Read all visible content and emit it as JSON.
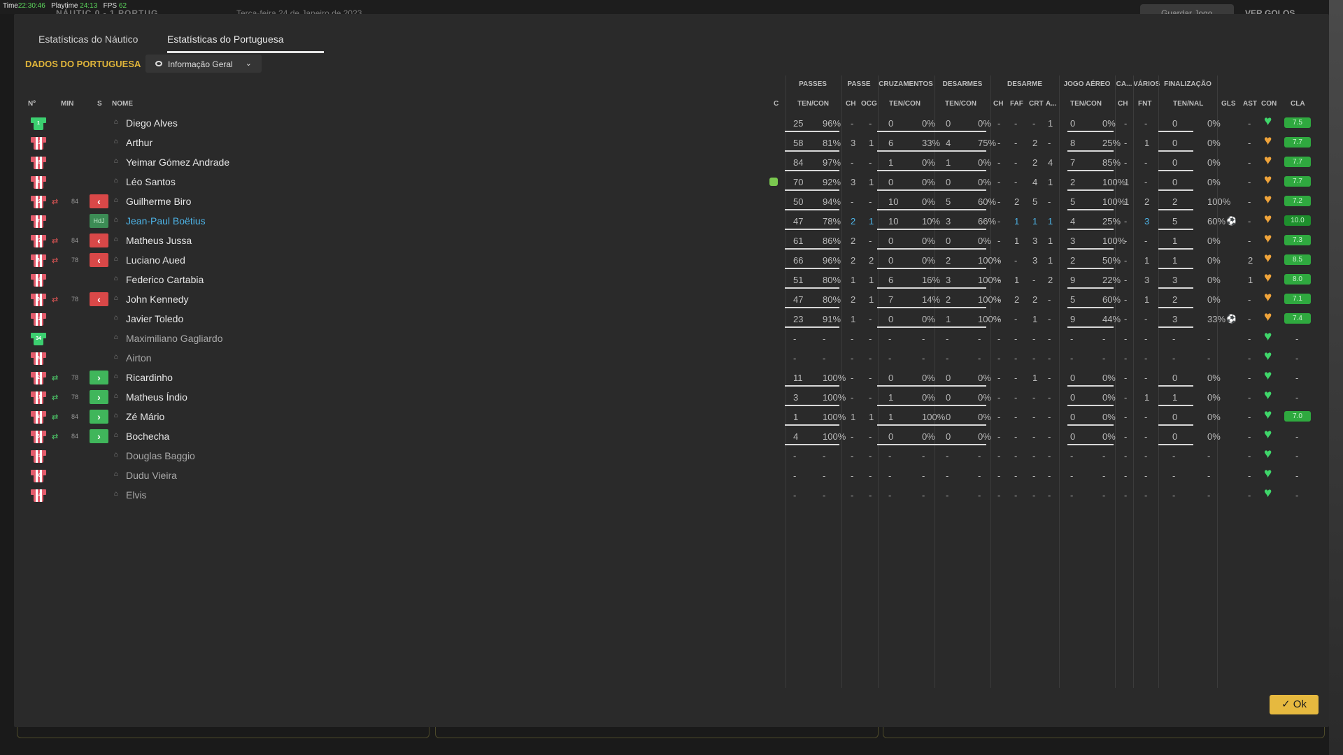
{
  "topbar": {
    "time_label": "Time",
    "time": "22:30:46",
    "playtime_label": "Playtime",
    "playtime": "24:13",
    "fps_label": "FPS",
    "fps": "62",
    "score": "NÁUTIC 0 - 1 PORTUG",
    "date": "Terça-feira 24 de Janeiro de 2023",
    "save_label": "Guardar Jogo",
    "goals_label": "VER GOLOS"
  },
  "tabs": [
    {
      "label": "Estatísticas do Náutico"
    },
    {
      "label": "Estatísticas do Portuguesa"
    }
  ],
  "section_title": "DADOS DO PORTUGUESA",
  "dropdown_label": "Informação Geral",
  "groups": {
    "passes": "PASSES",
    "passe": "PASSE",
    "cruzamentos": "CRUZAMENTOS",
    "desarmes": "DESARMES",
    "desarme": "DESARME",
    "jogo_aereo": "JOGO AÉREO",
    "ca": "CA...",
    "varios": "VÁRIOS",
    "finalizacao": "FINALIZAÇÃO"
  },
  "cols": {
    "no": "Nº",
    "min": "MIN",
    "s": "S",
    "nome": "NOME",
    "c": "C",
    "passes_tc": "TEN/CON",
    "passe_ch": "CH",
    "passe_ocg": "OCG",
    "cruz_tc": "TEN/CON",
    "des_tc": "TEN/CON",
    "d_ch": "CH",
    "d_faf": "FAF",
    "d_crt": "CRT",
    "d_a": "A...",
    "aer_tc": "TEN/CON",
    "ca_ch": "CH",
    "fnt": "FNT",
    "fin_tn": "TEN/NAL",
    "gls": "GLS",
    "ast": "AST",
    "con": "CON",
    "cla": "CLA"
  },
  "rows": [
    {
      "num": "1",
      "gk": true,
      "name": "Diego Alves",
      "v": [
        "25",
        "96%",
        "-",
        "-",
        "0",
        "0%",
        "0",
        "0%",
        "-",
        "-",
        "-",
        "1",
        "0",
        "0%",
        "-",
        "-",
        "0",
        "0%",
        "",
        "-"
      ],
      "con": "green",
      "rating": "7.5"
    },
    {
      "num": "13",
      "name": "Arthur",
      "v": [
        "58",
        "81%",
        "3",
        "1",
        "6",
        "33%",
        "4",
        "75%",
        "-",
        "-",
        "2",
        "-",
        "8",
        "25%",
        "-",
        "1",
        "0",
        "0%",
        "",
        "-"
      ],
      "con": "orange",
      "rating": "7.7"
    },
    {
      "num": "28",
      "name": "Yeimar Gómez Andrade",
      "v": [
        "84",
        "97%",
        "-",
        "-",
        "1",
        "0%",
        "1",
        "0%",
        "-",
        "-",
        "2",
        "4",
        "7",
        "85%",
        "-",
        "-",
        "0",
        "0%",
        "",
        "-"
      ],
      "con": "orange",
      "rating": "7.7"
    },
    {
      "num": "4",
      "name": "Léo Santos",
      "card": true,
      "v": [
        "70",
        "92%",
        "3",
        "1",
        "0",
        "0%",
        "0",
        "0%",
        "-",
        "-",
        "4",
        "1",
        "2",
        "100%",
        "1",
        "-",
        "0",
        "0%",
        "",
        "-"
      ],
      "con": "orange",
      "rating": "7.7"
    },
    {
      "num": "22",
      "sub": "out",
      "min": "84",
      "name": "Guilherme Biro",
      "v": [
        "50",
        "94%",
        "-",
        "-",
        "10",
        "0%",
        "5",
        "60%",
        "-",
        "2",
        "5",
        "-",
        "5",
        "100%",
        "1",
        "2",
        "2",
        "100%",
        "",
        "-"
      ],
      "con": "orange",
      "rating": "7.2"
    },
    {
      "num": "7",
      "hdj": "HdJ",
      "motm": true,
      "name": "Jean-Paul Boëtius",
      "v": [
        "47",
        "78%",
        "2",
        "1",
        "10",
        "10%",
        "3",
        "66%",
        "-",
        "1",
        "1",
        "1",
        "4",
        "25%",
        "-",
        "3",
        "5",
        "60%",
        "3",
        "-"
      ],
      "con": "orange",
      "rating": "10.0",
      "goals": true
    },
    {
      "num": "27",
      "sub": "out",
      "min": "84",
      "name": "Matheus Jussa",
      "v": [
        "61",
        "86%",
        "2",
        "-",
        "0",
        "0%",
        "0",
        "0%",
        "-",
        "1",
        "3",
        "1",
        "3",
        "100%",
        "-",
        "-",
        "1",
        "0%",
        "",
        "-"
      ],
      "con": "orange",
      "rating": "7.3"
    },
    {
      "num": "6",
      "sub": "out",
      "min": "78",
      "name": "Luciano Aued",
      "v": [
        "66",
        "96%",
        "2",
        "2",
        "0",
        "0%",
        "2",
        "100%",
        "-",
        "-",
        "3",
        "1",
        "2",
        "50%",
        "-",
        "1",
        "1",
        "0%",
        "",
        "2"
      ],
      "con": "orange",
      "rating": "8.5"
    },
    {
      "num": "10",
      "name": "Federico Cartabia",
      "v": [
        "51",
        "80%",
        "1",
        "1",
        "6",
        "16%",
        "3",
        "100%",
        "-",
        "1",
        "-",
        "2",
        "9",
        "22%",
        "-",
        "3",
        "3",
        "0%",
        "",
        "1"
      ],
      "con": "orange",
      "rating": "8.0"
    },
    {
      "num": "9",
      "sub": "out",
      "min": "78",
      "name": "John Kennedy",
      "v": [
        "47",
        "80%",
        "2",
        "1",
        "7",
        "14%",
        "2",
        "100%",
        "-",
        "2",
        "2",
        "-",
        "5",
        "60%",
        "-",
        "1",
        "2",
        "0%",
        "",
        "-"
      ],
      "con": "orange",
      "rating": "7.1"
    },
    {
      "num": "12",
      "name": "Javier Toledo",
      "v": [
        "23",
        "91%",
        "1",
        "-",
        "0",
        "0%",
        "1",
        "100%",
        "-",
        "-",
        "1",
        "-",
        "9",
        "44%",
        "-",
        "-",
        "3",
        "33%",
        "",
        "-"
      ],
      "con": "orange",
      "rating": "7.4",
      "goals": true
    },
    {
      "num": "34",
      "gk": true,
      "bench": true,
      "name": "Maximiliano Gagliardo",
      "v": [
        "-",
        "-",
        "-",
        "-",
        "-",
        "-",
        "-",
        "-",
        "-",
        "-",
        "-",
        "-",
        "-",
        "-",
        "-",
        "-",
        "-",
        "-",
        "",
        "-"
      ],
      "con": "green",
      "rating": "-"
    },
    {
      "num": "5",
      "bench": true,
      "name": "Airton",
      "v": [
        "-",
        "-",
        "-",
        "-",
        "-",
        "-",
        "-",
        "-",
        "-",
        "-",
        "-",
        "-",
        "-",
        "-",
        "-",
        "-",
        "-",
        "-",
        "",
        "-"
      ],
      "con": "green",
      "rating": "-"
    },
    {
      "num": "2",
      "sub": "in",
      "min": "78",
      "name": "Ricardinho",
      "v": [
        "11",
        "100%",
        "-",
        "-",
        "0",
        "0%",
        "0",
        "0%",
        "-",
        "-",
        "1",
        "-",
        "0",
        "0%",
        "-",
        "-",
        "0",
        "0%",
        "",
        "-"
      ],
      "con": "green",
      "rating": "-"
    },
    {
      "num": "11",
      "sub": "in",
      "min": "78",
      "name": "Matheus Índio",
      "v": [
        "3",
        "100%",
        "-",
        "-",
        "1",
        "0%",
        "0",
        "0%",
        "-",
        "-",
        "-",
        "-",
        "0",
        "0%",
        "-",
        "1",
        "1",
        "0%",
        "",
        "-"
      ],
      "con": "green",
      "rating": "-"
    },
    {
      "num": "8",
      "sub": "in",
      "min": "84",
      "name": "Zé Mário",
      "v": [
        "1",
        "100%",
        "1",
        "1",
        "1",
        "100%",
        "0",
        "0%",
        "-",
        "-",
        "-",
        "-",
        "0",
        "0%",
        "-",
        "-",
        "0",
        "0%",
        "",
        "-"
      ],
      "con": "green",
      "rating": "7.0"
    },
    {
      "num": "3",
      "sub": "in",
      "min": "84",
      "name": "Bochecha",
      "v": [
        "4",
        "100%",
        "-",
        "-",
        "0",
        "0%",
        "0",
        "0%",
        "-",
        "-",
        "-",
        "-",
        "0",
        "0%",
        "-",
        "-",
        "0",
        "0%",
        "",
        "-"
      ],
      "con": "green",
      "rating": "-"
    },
    {
      "num": "21",
      "bench": true,
      "name": "Douglas Baggio",
      "v": [
        "-",
        "-",
        "-",
        "-",
        "-",
        "-",
        "-",
        "-",
        "-",
        "-",
        "-",
        "-",
        "-",
        "-",
        "-",
        "-",
        "-",
        "-",
        "",
        "-"
      ],
      "con": "green",
      "rating": "-"
    },
    {
      "num": "30",
      "bench": true,
      "name": "Dudu Vieira",
      "v": [
        "-",
        "-",
        "-",
        "-",
        "-",
        "-",
        "-",
        "-",
        "-",
        "-",
        "-",
        "-",
        "-",
        "-",
        "-",
        "-",
        "-",
        "-",
        "",
        "-"
      ],
      "con": "green",
      "rating": "-"
    },
    {
      "num": "14",
      "bench": true,
      "name": "Elvis",
      "v": [
        "-",
        "-",
        "-",
        "-",
        "-",
        "-",
        "-",
        "-",
        "-",
        "-",
        "-",
        "-",
        "-",
        "-",
        "-",
        "-",
        "-",
        "-",
        "",
        "-"
      ],
      "con": "green",
      "rating": "-"
    }
  ],
  "ok_label": "Ok"
}
